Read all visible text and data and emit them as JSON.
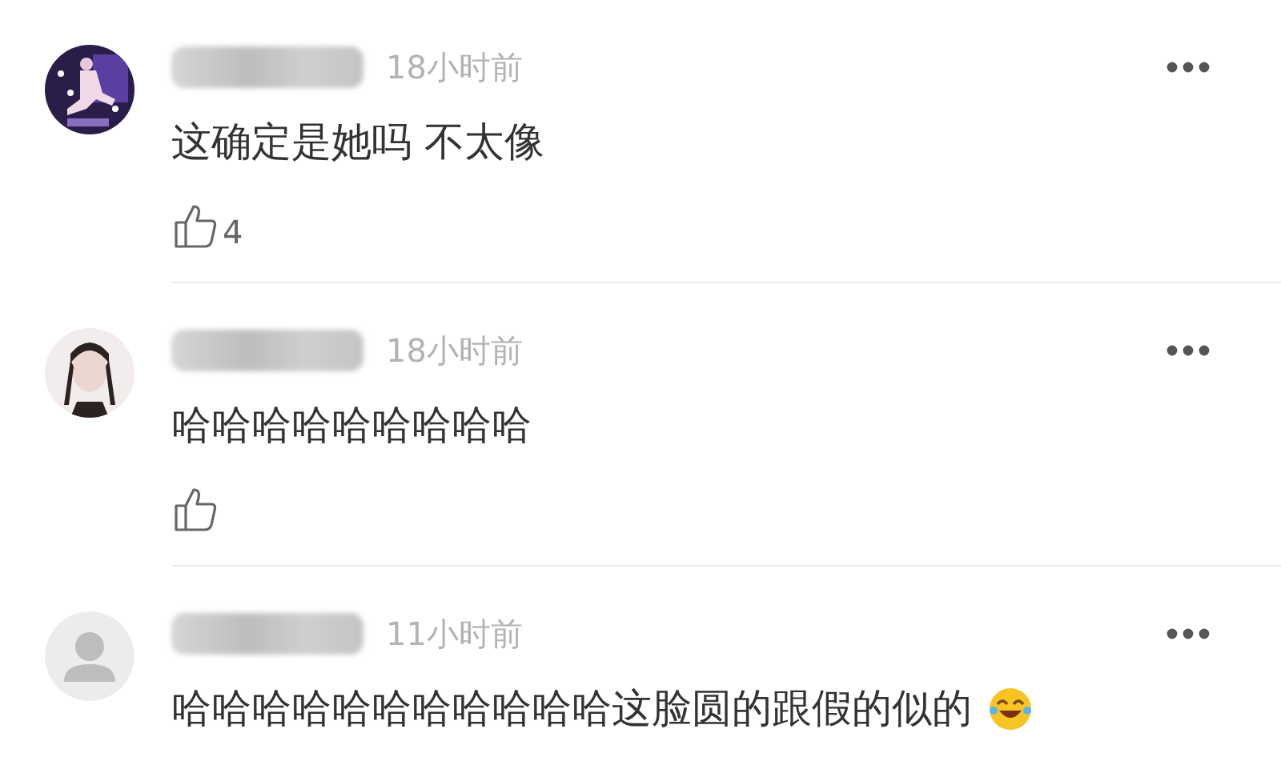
{
  "comments": [
    {
      "time": "18小时前",
      "text": "这确定是她吗 不太像",
      "like_shown": true,
      "like_count": "4"
    },
    {
      "time": "18小时前",
      "text": "哈哈哈哈哈哈哈哈哈",
      "like_shown": true
    },
    {
      "avatar": {
        "kind": "default"
      },
      "time": "11小时前",
      "text": "哈哈哈哈哈哈哈哈哈哈哈这脸圆的跟假的似的",
      "like_shown": false,
      "emoji": {
        "kind": "laughing"
      }
    }
  ]
}
